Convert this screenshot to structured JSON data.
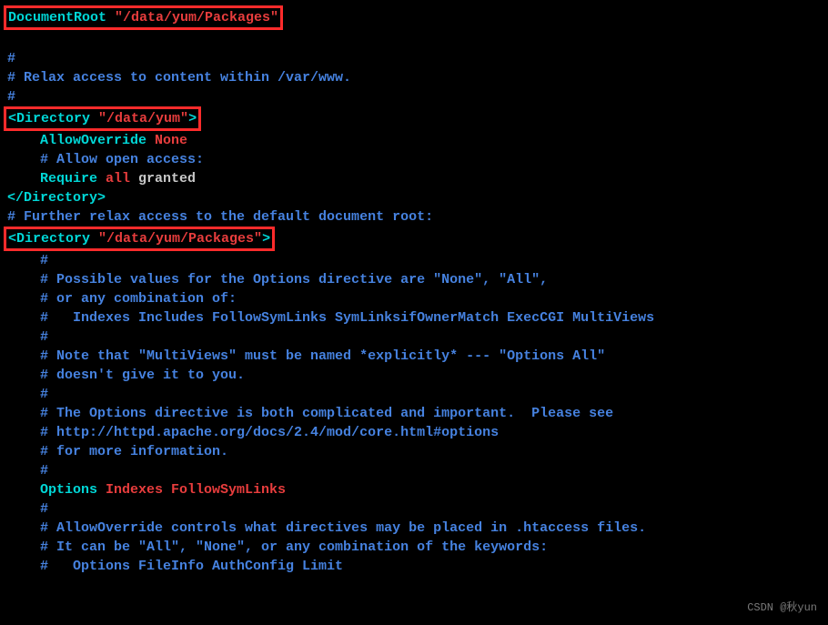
{
  "l1": {
    "a": "DocumentRoot ",
    "b": "\"/data/yum/Packages\""
  },
  "l2": "#",
  "l3": "# Relax access to content within /var/www.",
  "l4": "#",
  "l5": {
    "a": "<Directory ",
    "b": "\"/data/yum\"",
    "c": ">"
  },
  "l6": {
    "a": "    AllowOverride ",
    "b": "None"
  },
  "l7": "    # Allow open access:",
  "l8": {
    "a": "    Require ",
    "b": "all ",
    "c": "granted"
  },
  "l9": "</Directory>",
  "l10": "",
  "l11": "# Further relax access to the default document root:",
  "l12": {
    "a": "<Directory ",
    "b": "\"/data/yum/Packages\"",
    "c": ">"
  },
  "l13": "    #",
  "l14": "    # Possible values for the Options directive are \"None\", \"All\",",
  "l15": "    # or any combination of:",
  "l16": "    #   Indexes Includes FollowSymLinks SymLinksifOwnerMatch ExecCGI MultiViews",
  "l17": "    #",
  "l18": "    # Note that \"MultiViews\" must be named *explicitly* --- \"Options All\"",
  "l19": "    # doesn't give it to you.",
  "l20": "    #",
  "l21": "    # The Options directive is both complicated and important.  Please see",
  "l22": "    # http://httpd.apache.org/docs/2.4/mod/core.html#options",
  "l23": "    # for more information.",
  "l24": "    #",
  "l25": {
    "a": "    Options ",
    "b": "Indexes FollowSymLinks"
  },
  "l26": "",
  "l27": "    #",
  "l28": "    # AllowOverride controls what directives may be placed in .htaccess files.",
  "l29": "    # It can be \"All\", \"None\", or any combination of the keywords:",
  "l30": "    #   Options FileInfo AuthConfig Limit",
  "watermark": "CSDN @秋yun"
}
